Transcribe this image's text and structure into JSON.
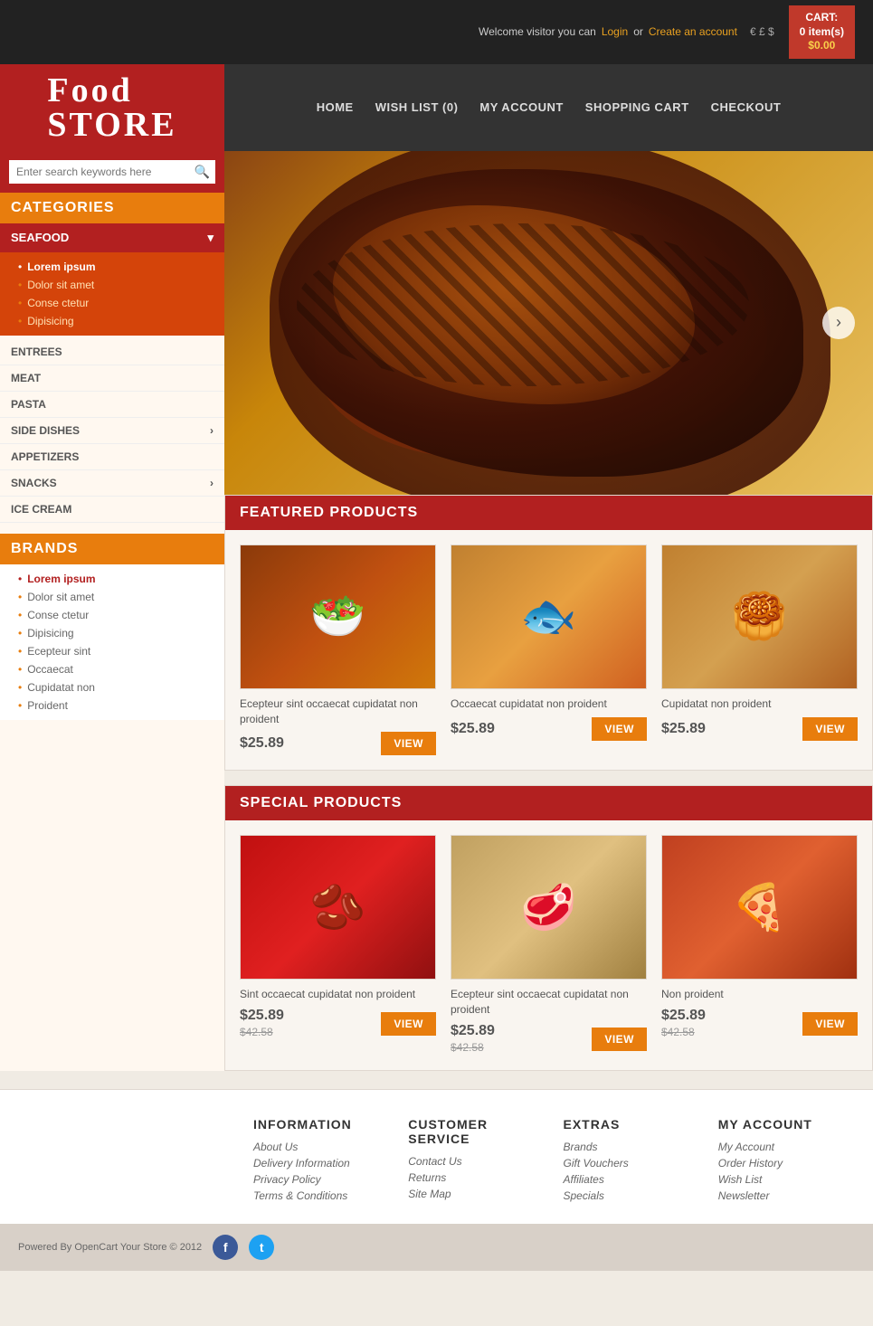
{
  "topbar": {
    "welcome": "Welcome visitor you can",
    "login": "Login",
    "or": "or",
    "create_account": "Create an account",
    "currencies": "€  £  $",
    "cart_label": "CART:",
    "cart_items": "0 item(s)",
    "cart_price": "$0.00"
  },
  "nav": {
    "items": [
      "HOME",
      "WISH LIST (0)",
      "MY ACCOUNT",
      "SHOPPING CART",
      "CHECKOUT"
    ]
  },
  "logo": {
    "line1": "Food",
    "line2": "STORE"
  },
  "search": {
    "placeholder": "Enter search keywords here"
  },
  "sidebar": {
    "categories_title": "CATEGORIES",
    "active_category": "SEAFOOD",
    "subcategories": [
      {
        "label": "Lorem ipsum",
        "active": true
      },
      {
        "label": "Dolor sit amet",
        "active": false
      },
      {
        "label": "Conse ctetur",
        "active": false
      },
      {
        "label": "Dipisicing",
        "active": false
      }
    ],
    "other_categories": [
      {
        "label": "ENTREES",
        "has_arrow": false
      },
      {
        "label": "MEAT",
        "has_arrow": false
      },
      {
        "label": "PASTA",
        "has_arrow": false
      },
      {
        "label": "SIDE DISHES",
        "has_arrow": true
      },
      {
        "label": "APPETIZERS",
        "has_arrow": false
      },
      {
        "label": "SNACKS",
        "has_arrow": true
      },
      {
        "label": "ICE CREAM",
        "has_arrow": false
      }
    ],
    "brands_title": "BRANDS",
    "brands": [
      {
        "label": "Lorem ipsum",
        "active": true
      },
      {
        "label": "Dolor sit amet",
        "active": false
      },
      {
        "label": "Conse ctetur",
        "active": false
      },
      {
        "label": "Dipisicing",
        "active": false
      },
      {
        "label": "Ecepteur sint",
        "active": false
      },
      {
        "label": "Occaecat",
        "active": false
      },
      {
        "label": "Cupidatat non",
        "active": false
      },
      {
        "label": "Proident",
        "active": false
      }
    ]
  },
  "hero": {
    "arrow": "›"
  },
  "featured": {
    "title": "FEATURED PRODUCTS",
    "products": [
      {
        "name": "Ecepteur sint occaecat cupidatat non proident",
        "price": "$25.89",
        "view": "VIEW",
        "emoji": "🥗"
      },
      {
        "name": "Occaecat cupidatat non proident",
        "price": "$25.89",
        "view": "VIEW",
        "emoji": "🐟"
      },
      {
        "name": "Cupidatat non proident",
        "price": "$25.89",
        "view": "VIEW",
        "emoji": "🥮"
      }
    ]
  },
  "special": {
    "title": "SPECIAL PRODUCTS",
    "products": [
      {
        "name": "Sint occaecat cupidatat non proident",
        "price": "$25.89",
        "old_price": "$42.58",
        "view": "VIEW",
        "emoji": "🫘"
      },
      {
        "name": "Ecepteur sint occaecat cupidatat non proident",
        "price": "$25.89",
        "old_price": "$42.58",
        "view": "VIEW",
        "emoji": "🥩"
      },
      {
        "name": "Non proident",
        "price": "$25.89",
        "old_price": "$42.58",
        "view": "VIEW",
        "emoji": "🍕"
      }
    ]
  },
  "footer": {
    "information": {
      "title": "INFORMATION",
      "links": [
        "About Us",
        "Delivery Information",
        "Privacy Policy",
        "Terms & Conditions"
      ]
    },
    "customer_service": {
      "title": "CUSTOMER SERVICE",
      "links": [
        "Contact Us",
        "Returns",
        "Site Map"
      ]
    },
    "extras": {
      "title": "EXTRAS",
      "links": [
        "Brands",
        "Gift Vouchers",
        "Affiliates",
        "Specials"
      ]
    },
    "my_account": {
      "title": "MY ACCOUNT",
      "links": [
        "My Account",
        "Order History",
        "Wish List",
        "Newsletter"
      ]
    },
    "copyright": "Powered By OpenCart Your Store © 2012"
  }
}
